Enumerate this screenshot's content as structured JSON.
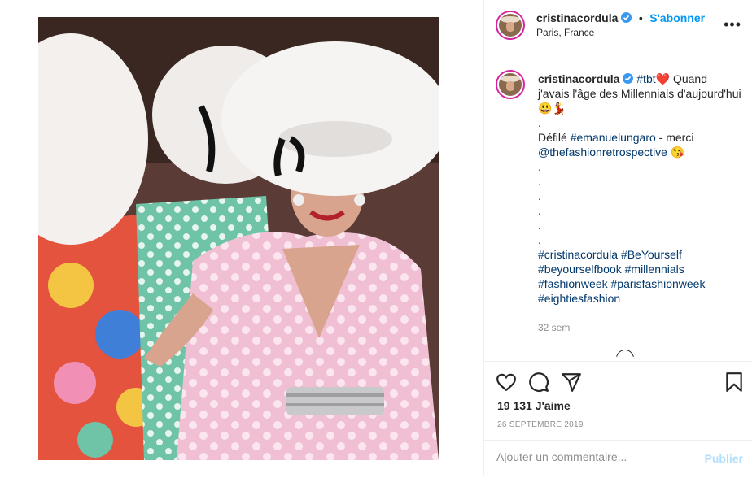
{
  "post": {
    "image_alt": "Fashion show photo: model in pink polka-dot dress and large white hat"
  },
  "header": {
    "username": "cristinacordula",
    "follow_label": "S'abonner",
    "separator": "•",
    "location": "Paris, France",
    "more_icon": "more-horizontal-icon",
    "verified_icon": "verified-badge-icon"
  },
  "caption": {
    "username": "cristinacordula",
    "line1_tag": "#tbt",
    "line1_emoji": "❤️",
    "line1_text": " Quand j'avais l'âge des Millennials d'aujourd'hui 😃💃",
    "dot": ".",
    "defile_prefix": "Défilé ",
    "defile_tag": "#emanuelungaro",
    "defile_suffix": " - merci",
    "mention": "@thefashionretrospective",
    "mention_emoji": " 😘",
    "hashtags_line1": "#cristinacordula #BeYourself",
    "hashtags_line2": "#beyourselfbook #millennials",
    "hashtags_line3": "#fashionweek #parisfashionweek",
    "hashtags_line4": "#eightiesfashion",
    "time_ago": "32 sem"
  },
  "actions": {
    "like_icon": "heart-icon",
    "comment_icon": "comment-icon",
    "share_icon": "share-icon",
    "save_icon": "bookmark-icon",
    "likes_count": "19 131",
    "likes_label": "J'aime",
    "date": "26 SEPTEMBRE 2019"
  },
  "comment": {
    "placeholder": "Ajouter un commentaire...",
    "publish_label": "Publier"
  },
  "colors": {
    "accent": "#0095f6",
    "hashtag": "#00376b",
    "muted": "#8e8e8e",
    "publish_disabled": "#b2dffc"
  }
}
